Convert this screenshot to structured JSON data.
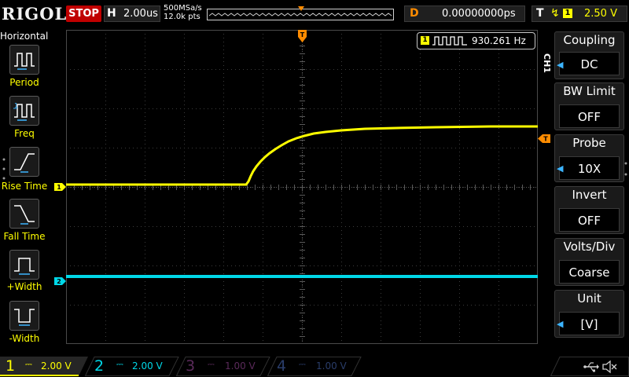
{
  "top": {
    "logo": "RIGOL",
    "run_state": "STOP",
    "timebase_letter": "H",
    "timebase": "2.00us",
    "sample_rate": "500MSa/s",
    "memory_depth": "12.0k pts",
    "delay_letter": "D",
    "delay": "0.00000000ps",
    "trigger_letter": "T",
    "trigger_source": "1",
    "trigger_level": "2.50 V"
  },
  "left_panel": {
    "title": "Horizontal",
    "items": [
      {
        "label": "Period",
        "icon": "period-icon"
      },
      {
        "label": "Freq",
        "icon": "freq-icon"
      },
      {
        "label": "Rise Time",
        "icon": "rise-time-icon"
      },
      {
        "label": "Fall Time",
        "icon": "fall-time-icon"
      },
      {
        "label": "+Width",
        "icon": "pos-width-icon"
      },
      {
        "label": "-Width",
        "icon": "neg-width-icon"
      }
    ]
  },
  "display": {
    "frequency_channel": "1",
    "frequency": "930.261 Hz",
    "trigger_marker": "T",
    "ch1_marker": "1",
    "ch2_marker": "2"
  },
  "right_menu": {
    "channel_tab": "CH1",
    "items": [
      {
        "title": "Coupling",
        "value": "DC"
      },
      {
        "title": "BW Limit",
        "value": "OFF"
      },
      {
        "title": "Probe",
        "value": "10X"
      },
      {
        "title": "Invert",
        "value": "OFF"
      },
      {
        "title": "Volts/Div",
        "value": "Coarse"
      },
      {
        "title": "Unit",
        "value": "[V]"
      }
    ]
  },
  "bottom": {
    "channels": [
      {
        "num": "1",
        "scale": "2.00 V",
        "color": "#ffff00"
      },
      {
        "num": "2",
        "scale": "2.00 V",
        "color": "#00d8e8"
      },
      {
        "num": "3",
        "scale": "1.00 V",
        "color": "#c040c0"
      },
      {
        "num": "4",
        "scale": "1.00 V",
        "color": "#3c78ff"
      }
    ]
  },
  "colors": {
    "ch1": "#ffff00",
    "ch2": "#00d8e8",
    "trigger": "#ff8c00",
    "stop": "#c00000",
    "menu_arrow": "#3cb4ff"
  }
}
